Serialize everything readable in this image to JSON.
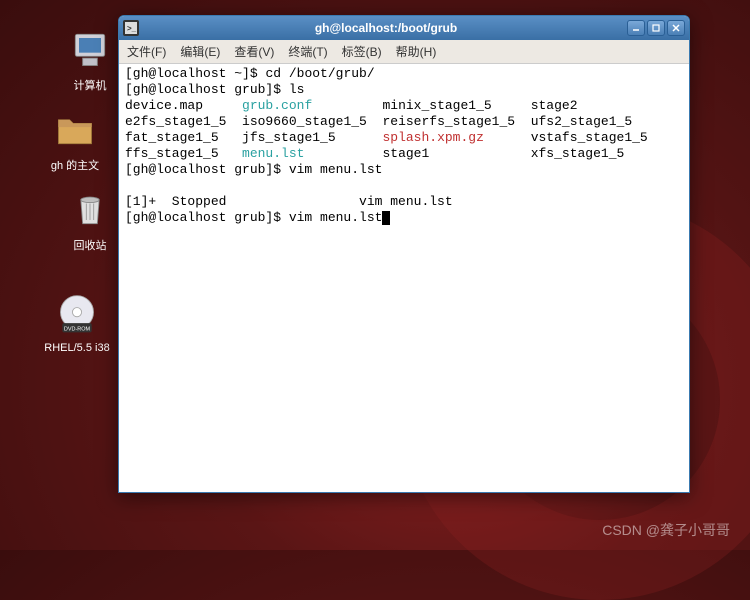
{
  "desktop": {
    "icons": [
      {
        "id": "computer",
        "label": "计算机"
      },
      {
        "id": "home",
        "label": "gh 的主文"
      },
      {
        "id": "trash",
        "label": "回收站"
      },
      {
        "id": "dvd",
        "label": "RHEL/5.5 i38"
      }
    ]
  },
  "window": {
    "title": "gh@localhost:/boot/grub",
    "menu": {
      "file": "文件(F)",
      "edit": "编辑(E)",
      "view": "查看(V)",
      "terminal": "终端(T)",
      "tabs": "标签(B)",
      "help": "帮助(H)"
    }
  },
  "terminal": {
    "prompt1": "[gh@localhost ~]$ ",
    "cmd1": "cd /boot/grub/",
    "prompt2": "[gh@localhost grub]$ ",
    "cmd2": "ls",
    "ls": {
      "r1c1": "device.map",
      "r1c2": "grub.conf",
      "r1c3": "minix_stage1_5",
      "r1c4": "stage2",
      "r2c1": "e2fs_stage1_5",
      "r2c2": "iso9660_stage1_5",
      "r2c3": "reiserfs_stage1_5",
      "r2c4": "ufs2_stage1_5",
      "r3c1": "fat_stage1_5",
      "r3c2": "jfs_stage1_5",
      "r3c3": "splash.xpm.gz",
      "r3c4": "vstafs_stage1_5",
      "r4c1": "ffs_stage1_5",
      "r4c2": "menu.lst",
      "r4c3": "stage1",
      "r4c4": "xfs_stage1_5"
    },
    "prompt3": "[gh@localhost grub]$ ",
    "cmd3": "vim menu.lst",
    "stopped": "[1]+  Stopped                 vim menu.lst",
    "prompt4": "[gh@localhost grub]$ ",
    "cmd4": "vim menu.lst"
  },
  "watermark": "CSDN @龚子小哥哥"
}
